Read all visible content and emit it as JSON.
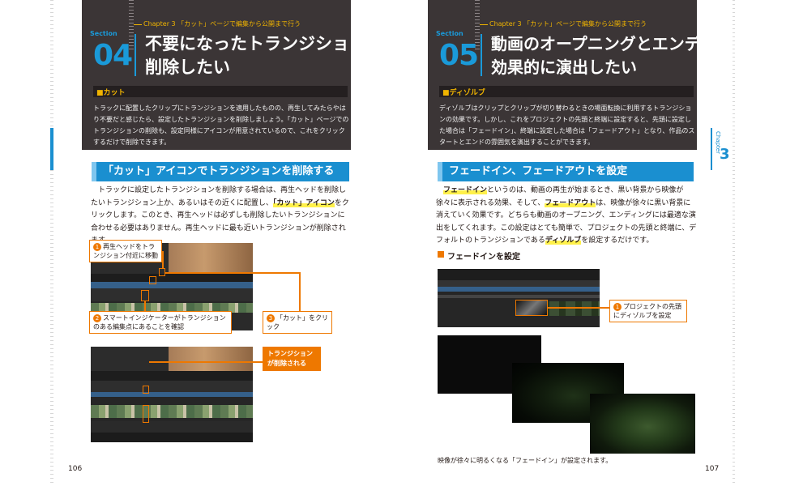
{
  "left_page": {
    "chapter_line": "Chapter 3 「カット」ページで編集から公開まで行う",
    "section_word": "Section",
    "section_number": "04",
    "title_line1": "不要になったトランジションを",
    "title_line2": "削除したい",
    "tag": "■カット",
    "intro": "トラックに配置したクリップにトランジションを適用したものの、再生してみたらやはり不要だと感じたら、設定したトランジションを削除しましょう。「カット」ページでのトランジションの削除も、設定同様にアイコンが用意されているので、これをクリックするだけで削除できます。",
    "heading": "「カット」アイコンでトランジションを削除する",
    "body_part1": "トラックに設定したトランジションを削除する場合は、再生ヘッドを削除したいトランジション上か、あるいはその近くに配置し、",
    "body_highlight": "「カット」アイコン",
    "body_part2": "をクリックします。このとき、再生ヘッドは必ずしも削除したいトランジションに合わせる必要はありません。再生ヘッドに最も近いトランジションが削除されます。",
    "callout1_num": "1",
    "callout1": "再生ヘッドをトランジション付近に移動",
    "callout2_num": "2",
    "callout2": "スマートインジケーターがトランジションのある編集点にあることを確認",
    "callout3_num": "3",
    "callout3": "「カット」をクリック",
    "callout4": "トランジションが削除される",
    "page_number": "106"
  },
  "right_page": {
    "chapter_line": "Chapter 3 「カット」ページで編集から公開まで行う",
    "section_word": "Section",
    "section_number": "05",
    "title_line1": "動画のオープニングとエンディングを",
    "title_line2": "効果的に演出したい",
    "tag": "■ディゾルブ",
    "intro": "ディゾルブはクリップとクリップが切り替わるときの場面転換に利用するトランジションの効果です。しかし、これをプロジェクトの先頭と終端に設定すると、先頭に設定した場合は「フェードイン」、終端に設定した場合は「フェードアウト」となり、作品のスタートとエンドの雰囲気を演出することができます。",
    "heading": "フェードイン、フェードアウトを設定",
    "body_hl1": "フェードイン",
    "body_a": "というのは、動画の再生が始まるとき、黒い背景から映像が徐々に表示される効果、そして、",
    "body_hl2": "フェードアウト",
    "body_b": "は、映像が徐々に黒い背景に消えていく効果です。どちらも動画のオープニング、エンディングには最適な演出をしてくれます。この設定はとても簡単で、プロジェクトの先頭と終端に、デフォルトのトランジションである",
    "body_hl3": "ディゾルブ",
    "body_c": "を設定するだけです。",
    "subheading": "フェードインを設定",
    "callout1_num": "1",
    "callout1": "プロジェクトの先頭にディゾルブを設定",
    "caption": "映像が徐々に明るくなる「フェードイン」が設定されます。",
    "chapter_tab_word": "Chapter",
    "chapter_tab_num": "3",
    "page_number": "107"
  },
  "colors": {
    "dark_box": "#3b3536",
    "accent_blue": "#1a8fd0",
    "accent_orange": "#ee7800",
    "chapter_yellow": "#f0b400",
    "highlight_yellow": "#fff14a"
  }
}
